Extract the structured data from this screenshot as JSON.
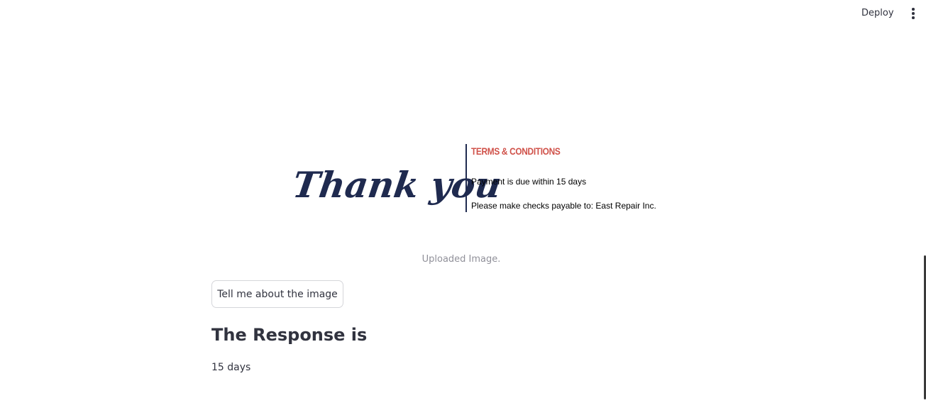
{
  "header": {
    "deploy_label": "Deploy",
    "menu_icon": "vertical-ellipsis-icon"
  },
  "uploaded_image": {
    "thank_you": "Thank you",
    "terms_heading": "TERMS & CONDITIONS",
    "line_1": "Payment is due within 15 days",
    "line_2": "Please make checks payable to: East Repair Inc.",
    "colors": {
      "script_text": "#1f2a4f",
      "heading": "#d0524a"
    },
    "caption": "Uploaded Image."
  },
  "main": {
    "action_button_label": "Tell me about the image",
    "response_heading": "The Response is",
    "response_text": "15 days"
  }
}
